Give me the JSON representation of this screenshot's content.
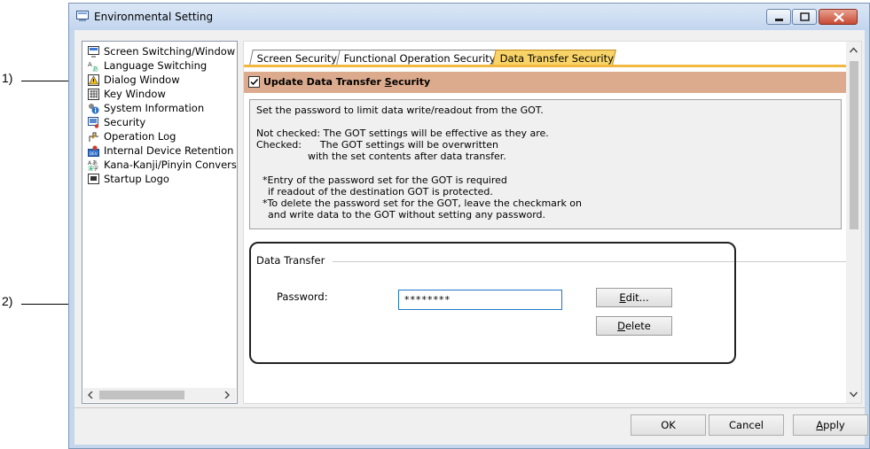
{
  "callouts": [
    "1)",
    "2)"
  ],
  "window": {
    "title": "Environmental Setting",
    "controls": [
      "minimize",
      "maximize",
      "close"
    ]
  },
  "tree": {
    "items": [
      {
        "label": "Screen Switching/Window",
        "icon": "screen-switch-icon"
      },
      {
        "label": "Language Switching",
        "icon": "language-icon"
      },
      {
        "label": "Dialog Window",
        "icon": "warning-dialog-icon"
      },
      {
        "label": "Key Window",
        "icon": "keyboard-icon"
      },
      {
        "label": "System Information",
        "icon": "system-info-icon"
      },
      {
        "label": "Security",
        "icon": "security-icon",
        "selected": true
      },
      {
        "label": "Operation Log",
        "icon": "operation-log-icon"
      },
      {
        "label": "Internal Device Retention",
        "icon": "device-retention-icon"
      },
      {
        "label": "Kana-Kanji/Pinyin Conversi",
        "icon": "kana-kanji-icon"
      },
      {
        "label": "Startup Logo",
        "icon": "startup-logo-icon"
      }
    ]
  },
  "tabs": [
    "Screen Security",
    "Functional Operation Security",
    "Data Transfer Security"
  ],
  "active_tab": "Data Transfer Security",
  "update_checkbox": {
    "label_prefix": "Update Data Transfer ",
    "label_key": "S",
    "label_suffix": "ecurity",
    "checked": true
  },
  "description": [
    "Set the password to limit data write/readout from the GOT.",
    "",
    "Not checked: The GOT settings will be effective as they are.",
    "Checked:      The GOT settings will be overwritten",
    "                   with the set contents after data transfer.",
    "",
    "  *Entry of the password set for the GOT is required",
    "    if readout of the destination GOT is protected.",
    "  *To delete the password set for the GOT, leave the checkmark on",
    "    and write data to the GOT without setting any password."
  ],
  "data_transfer": {
    "group_title": "Data Transfer",
    "password_label": "Password:",
    "password_value": "********",
    "edit_key": "E",
    "edit_rest": "dit...",
    "delete_key": "D",
    "delete_rest": "elete"
  },
  "footer": {
    "ok": "OK",
    "cancel": "Cancel",
    "apply_key": "A",
    "apply_rest": "pply"
  },
  "colors": {
    "active_tab": "#f8d468",
    "header_bar": "#dcab8d",
    "window_frame": "#c4d6ec"
  }
}
